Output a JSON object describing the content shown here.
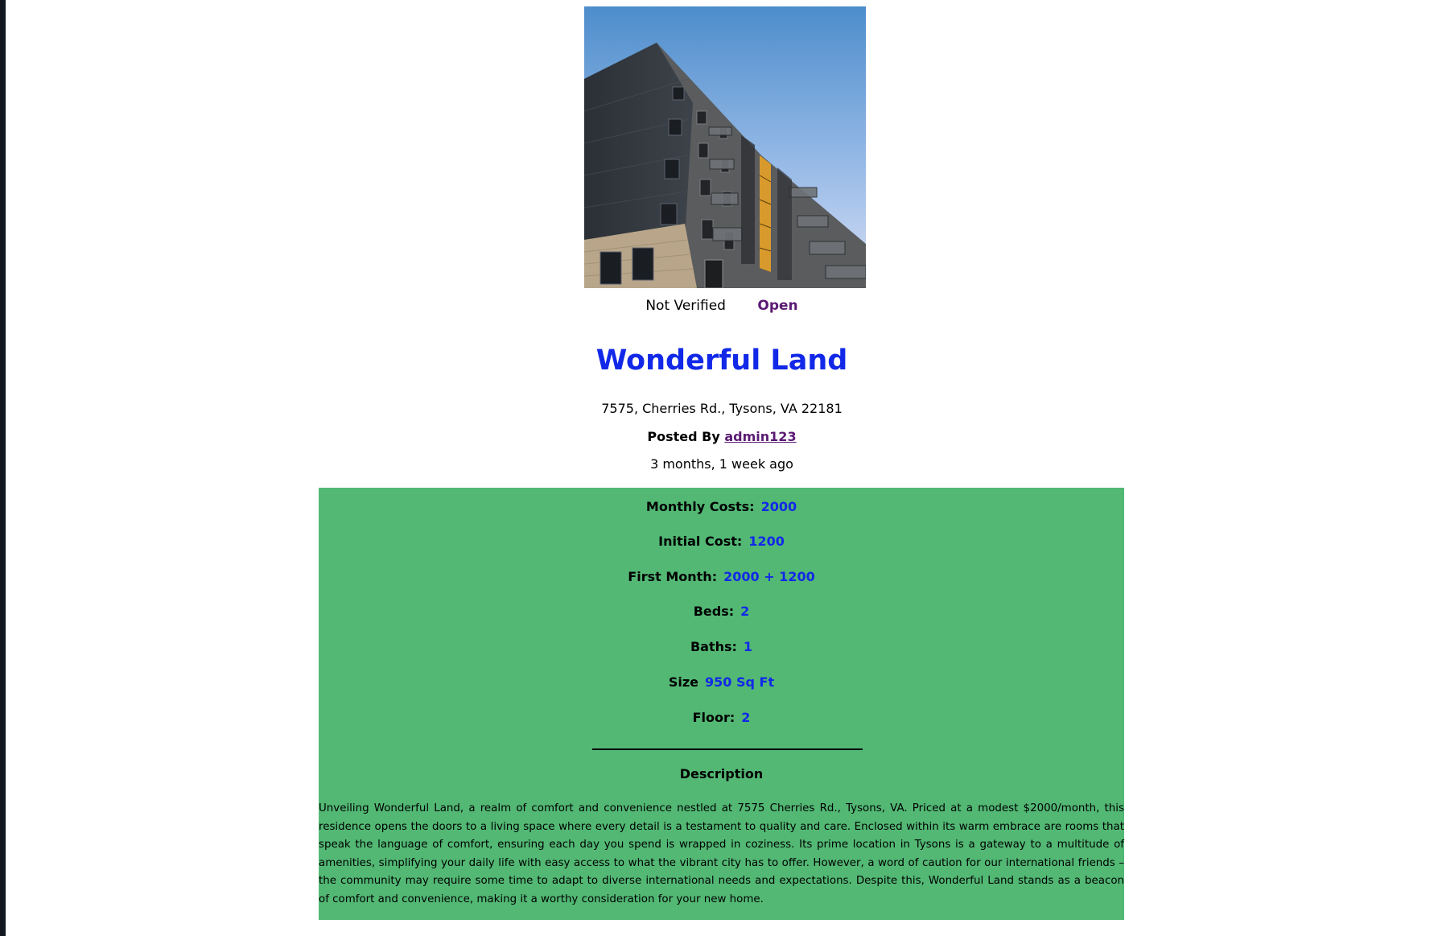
{
  "listing": {
    "verification_status": "Not Verified",
    "availability": "Open",
    "title": "Wonderful Land",
    "address": "7575, Cherries Rd., Tysons, VA 22181",
    "posted_by_label": "Posted By",
    "posted_by_user": "admin123",
    "posted_ago": "3 months, 1 week ago",
    "photo_icon": "apartment-building-photo"
  },
  "details": [
    {
      "label": "Monthly Costs:",
      "value": "2000"
    },
    {
      "label": "Initial Cost:",
      "value": "1200"
    },
    {
      "label": "First Month:",
      "value": "2000 + 1200"
    },
    {
      "label": "Beds:",
      "value": "2"
    },
    {
      "label": "Baths:",
      "value": "1"
    },
    {
      "label": "Size",
      "value": "950 Sq Ft"
    },
    {
      "label": "Floor:",
      "value": "2"
    }
  ],
  "description": {
    "heading": "Description",
    "body": "Unveiling Wonderful Land, a realm of comfort and convenience nestled at 7575 Cherries Rd., Tysons, VA. Priced at a modest $2000/month, this residence opens the doors to a living space where every detail is a testament to quality and care. Enclosed within its warm embrace are rooms that speak the language of comfort, ensuring each day you spend is wrapped in coziness. Its prime location in Tysons is a gateway to a multitude of amenities, simplifying your daily life with easy access to what the vibrant city has to offer. However, a word of caution for our international friends – the community may require some time to adapt to diverse international needs and expectations. Despite this, Wonderful Land stands as a beacon of comfort and convenience, making it a worthy consideration for your new home."
  },
  "colors": {
    "details_background": "#52b874",
    "title": "#1228e8",
    "value": "#1228e8",
    "link": "#5a1a73"
  }
}
